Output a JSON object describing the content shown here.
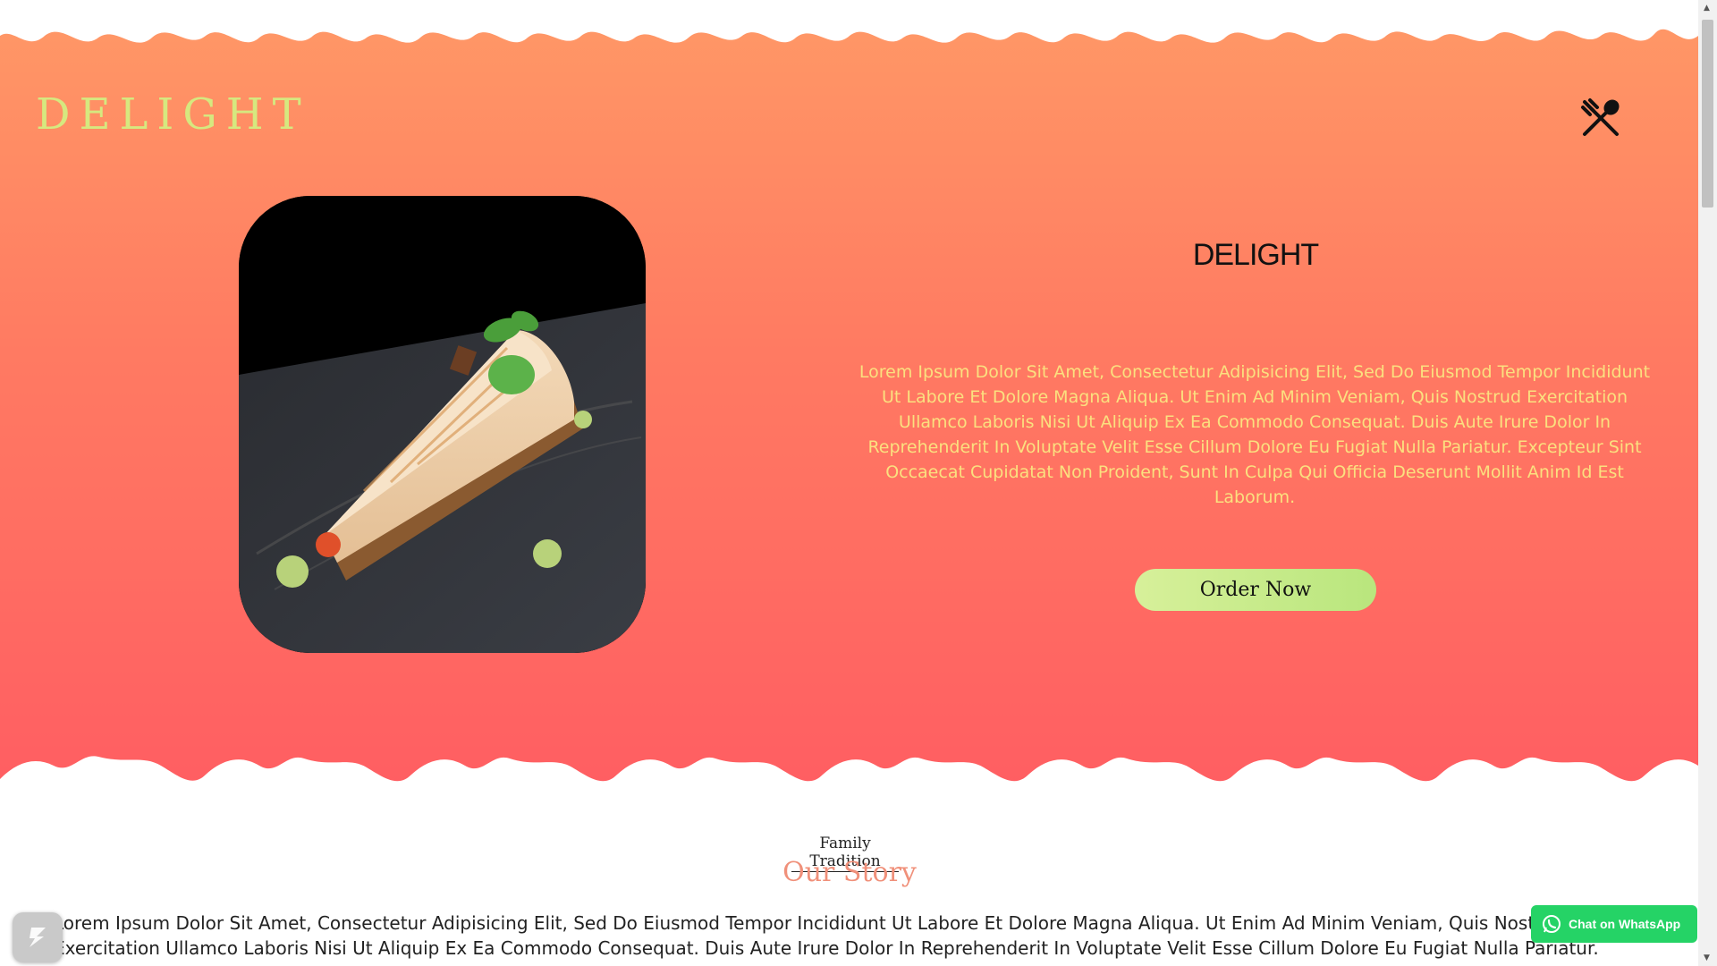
{
  "brand": {
    "logo_text": "DELIGHT",
    "menu_icon": "utensils-icon"
  },
  "hero": {
    "title": "DELIGHT",
    "description": "Lorem Ipsum Dolor Sit Amet, Consectetur Adipisicing Elit, Sed Do Eiusmod Tempor Incididunt Ut Labore Et Dolore Magna Aliqua. Ut Enim Ad Minim Veniam, Quis Nostrud Exercitation Ullamco Laboris Nisi Ut Aliquip Ex Ea Commodo Consequat. Duis Aute Irure Dolor In Reprehenderit In Voluptate Velit Esse Cillum Dolore Eu Fugiat Nulla Pariatur. Excepteur Sint Occaecat Cupidatat Non Proident, Sunt In Culpa Qui Officia Deserunt Mollit Anim Id Est Laborum.",
    "cta_label": "Order Now",
    "image_subject": "cheesecake-slice"
  },
  "story": {
    "eyebrow": "Family Tradition",
    "title": "Our Story",
    "text": "Lorem Ipsum Dolor Sit Amet, Consectetur Adipisicing Elit, Sed Do Eiusmod Tempor Incididunt Ut Labore Et Dolore Magna Aliqua. Ut Enim Ad Minim Veniam, Quis Nostrud Exercitation Ullamco Laboris Nisi Ut Aliquip Ex Ea Commodo Consequat. Duis Aute Irure Dolor In Reprehenderit In Voluptate Velit Esse Cillum Dolore Eu Fugiat Nulla Pariatur. Excepteur Sint Occaecat"
  },
  "whatsapp": {
    "label": "Chat on WhatsApp"
  },
  "colors": {
    "gradient_top": "#ff9966",
    "gradient_bottom": "#ff5e62",
    "logo": "#d6e87f",
    "description": "#fbe07f",
    "button": "#c8eb8a",
    "story_title": "#f0907a",
    "whatsapp": "#25d366"
  }
}
